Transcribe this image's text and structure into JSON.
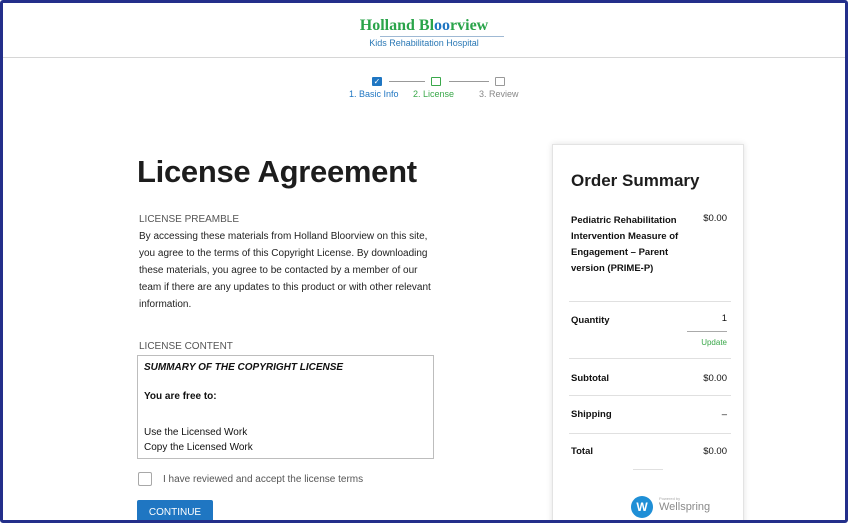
{
  "header": {
    "logo_title_1": "Holland Bl",
    "logo_title_2": "oo",
    "logo_title_3": "rview",
    "logo_subtitle": "Kids Rehabilitation Hospital"
  },
  "steps": [
    {
      "label": "1. Basic Info",
      "state": "done",
      "mark": "✓"
    },
    {
      "label": "2. License",
      "state": "active"
    },
    {
      "label": "3. Review",
      "state": "todo"
    }
  ],
  "main": {
    "title": "License Agreement",
    "preamble_label": "LICENSE PREAMBLE",
    "preamble_text": "By accessing these materials from Holland Bloorview on this site, you agree to the terms of this Copyright License. By downloading these materials, you agree to be contacted by a member of our team if there are any updates to this product or with other relevant information.",
    "content_label": "LICENSE CONTENT",
    "content_lines": [
      "SUMMARY OF THE COPYRIGHT LICENSE",
      "You are free to:",
      "Use the Licensed Work",
      "Copy the Licensed Work"
    ],
    "accept_label": "I have reviewed and accept the license terms",
    "accept_checked": false,
    "continue_label": "CONTINUE"
  },
  "order_summary": {
    "title": "Order Summary",
    "product_name": "Pediatric Rehabilitation Intervention Measure of Engagement – Parent version (PRIME-P)",
    "product_price": "$0.00",
    "quantity_label": "Quantity",
    "quantity_value": "1",
    "update_label": "Update",
    "subtotal_label": "Subtotal",
    "subtotal_value": "$0.00",
    "shipping_label": "Shipping",
    "shipping_value": "–",
    "total_label": "Total",
    "total_value": "$0.00",
    "powered_by": "Powered by",
    "brand": "Wellspring"
  },
  "colors": {
    "accent_blue": "#1f76c2",
    "accent_green": "#3aa84a",
    "logo_green": "#2aa44a",
    "frame_border": "#232f8a"
  }
}
